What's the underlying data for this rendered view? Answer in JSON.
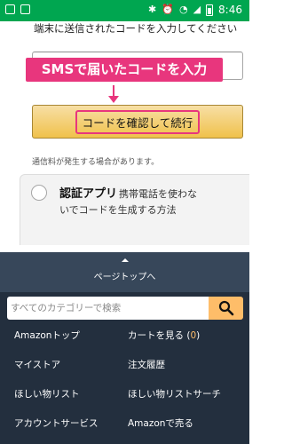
{
  "status_bar": {
    "time": "8:46"
  },
  "otp_page": {
    "instruction": "端末に送信されたコードを入力してください",
    "overlay_label": "SMSで届いたコードを入力",
    "confirm_button": "コードを確認して続行",
    "fee_note": "通信料が発生する場合があります。",
    "auth_app": {
      "title": "認証アプリ",
      "desc_line1": "携帯電話を使わな",
      "desc_line2": "いでコードを生成する方法"
    }
  },
  "footer": {
    "back_to_top": "ページトップへ",
    "search_placeholder": "すべてのカテゴリーで検索",
    "links": [
      {
        "label": "Amazonトップ"
      },
      {
        "label": "カートを見る ("
      },
      {
        "label": "マイストア"
      },
      {
        "label": "注文履歴"
      },
      {
        "label": "ほしい物リスト"
      },
      {
        "label": "ほしい物リストサーチ"
      },
      {
        "label": "アカウントサービス"
      },
      {
        "label": "Amazonで売る"
      }
    ],
    "cart_count": "0",
    "cart_close": ")"
  },
  "colors": {
    "status_bar": "#00a650",
    "highlight": "#e8367d",
    "button_yellow": "#f0c14b",
    "footer_bg": "#232f3e",
    "footer_top": "#37475a",
    "search_button": "#febd69"
  }
}
